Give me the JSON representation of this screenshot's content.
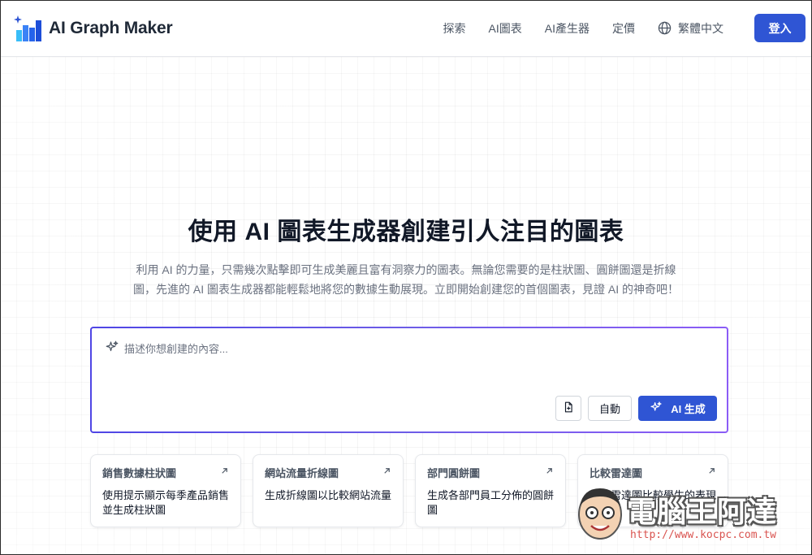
{
  "header": {
    "brand": "AI Graph Maker",
    "nav": [
      "探索",
      "AI圖表",
      "AI產生器",
      "定價"
    ],
    "language": "繁體中文",
    "login_label": "登入"
  },
  "hero": {
    "title": "使用 AI 圖表生成器創建引人注目的圖表",
    "subtitle_line1": "利用 AI 的力量，只需幾次點擊即可生成美麗且富有洞察力的圖表。無論您需要的是柱狀圖、圓餅圖還是折線",
    "subtitle_line2": "圖，先進的 AI 圖表生成器都能輕鬆地將您的數據生動展現。立即開始創建您的首個圖表，見證 AI 的神奇吧！"
  },
  "prompt": {
    "placeholder": "描述你想創建的內容...",
    "auto_label": "自動",
    "generate_label": "AI 生成"
  },
  "cards": [
    {
      "title": "銷售數據柱狀圖",
      "desc_line1": "使用提示顯示每季產品銷售",
      "desc_line2": "並生成柱狀圖"
    },
    {
      "title": "網站流量折線圖",
      "desc_line1": "生成折線圖以比較網站流量",
      "desc_line2": ""
    },
    {
      "title": "部門圓餅圖",
      "desc_line1": "生成各部門員工分佈的圓餅",
      "desc_line2": "圖"
    },
    {
      "title": "比較雷達圖",
      "desc_line1": "使用雷達圖比較學生的表現",
      "desc_line2": ""
    }
  ],
  "watermark": {
    "text": "電腦王阿達",
    "url": "http://www.kocpc.com.tw"
  },
  "colors": {
    "primary": "#2f55d4",
    "gradient_start": "#4f46e5",
    "gradient_end": "#8b5cf6"
  },
  "icons": [
    "brand-logo-icon",
    "globe-icon",
    "sparkle-icon",
    "file-upload-icon",
    "arrow-up-right-icon"
  ]
}
